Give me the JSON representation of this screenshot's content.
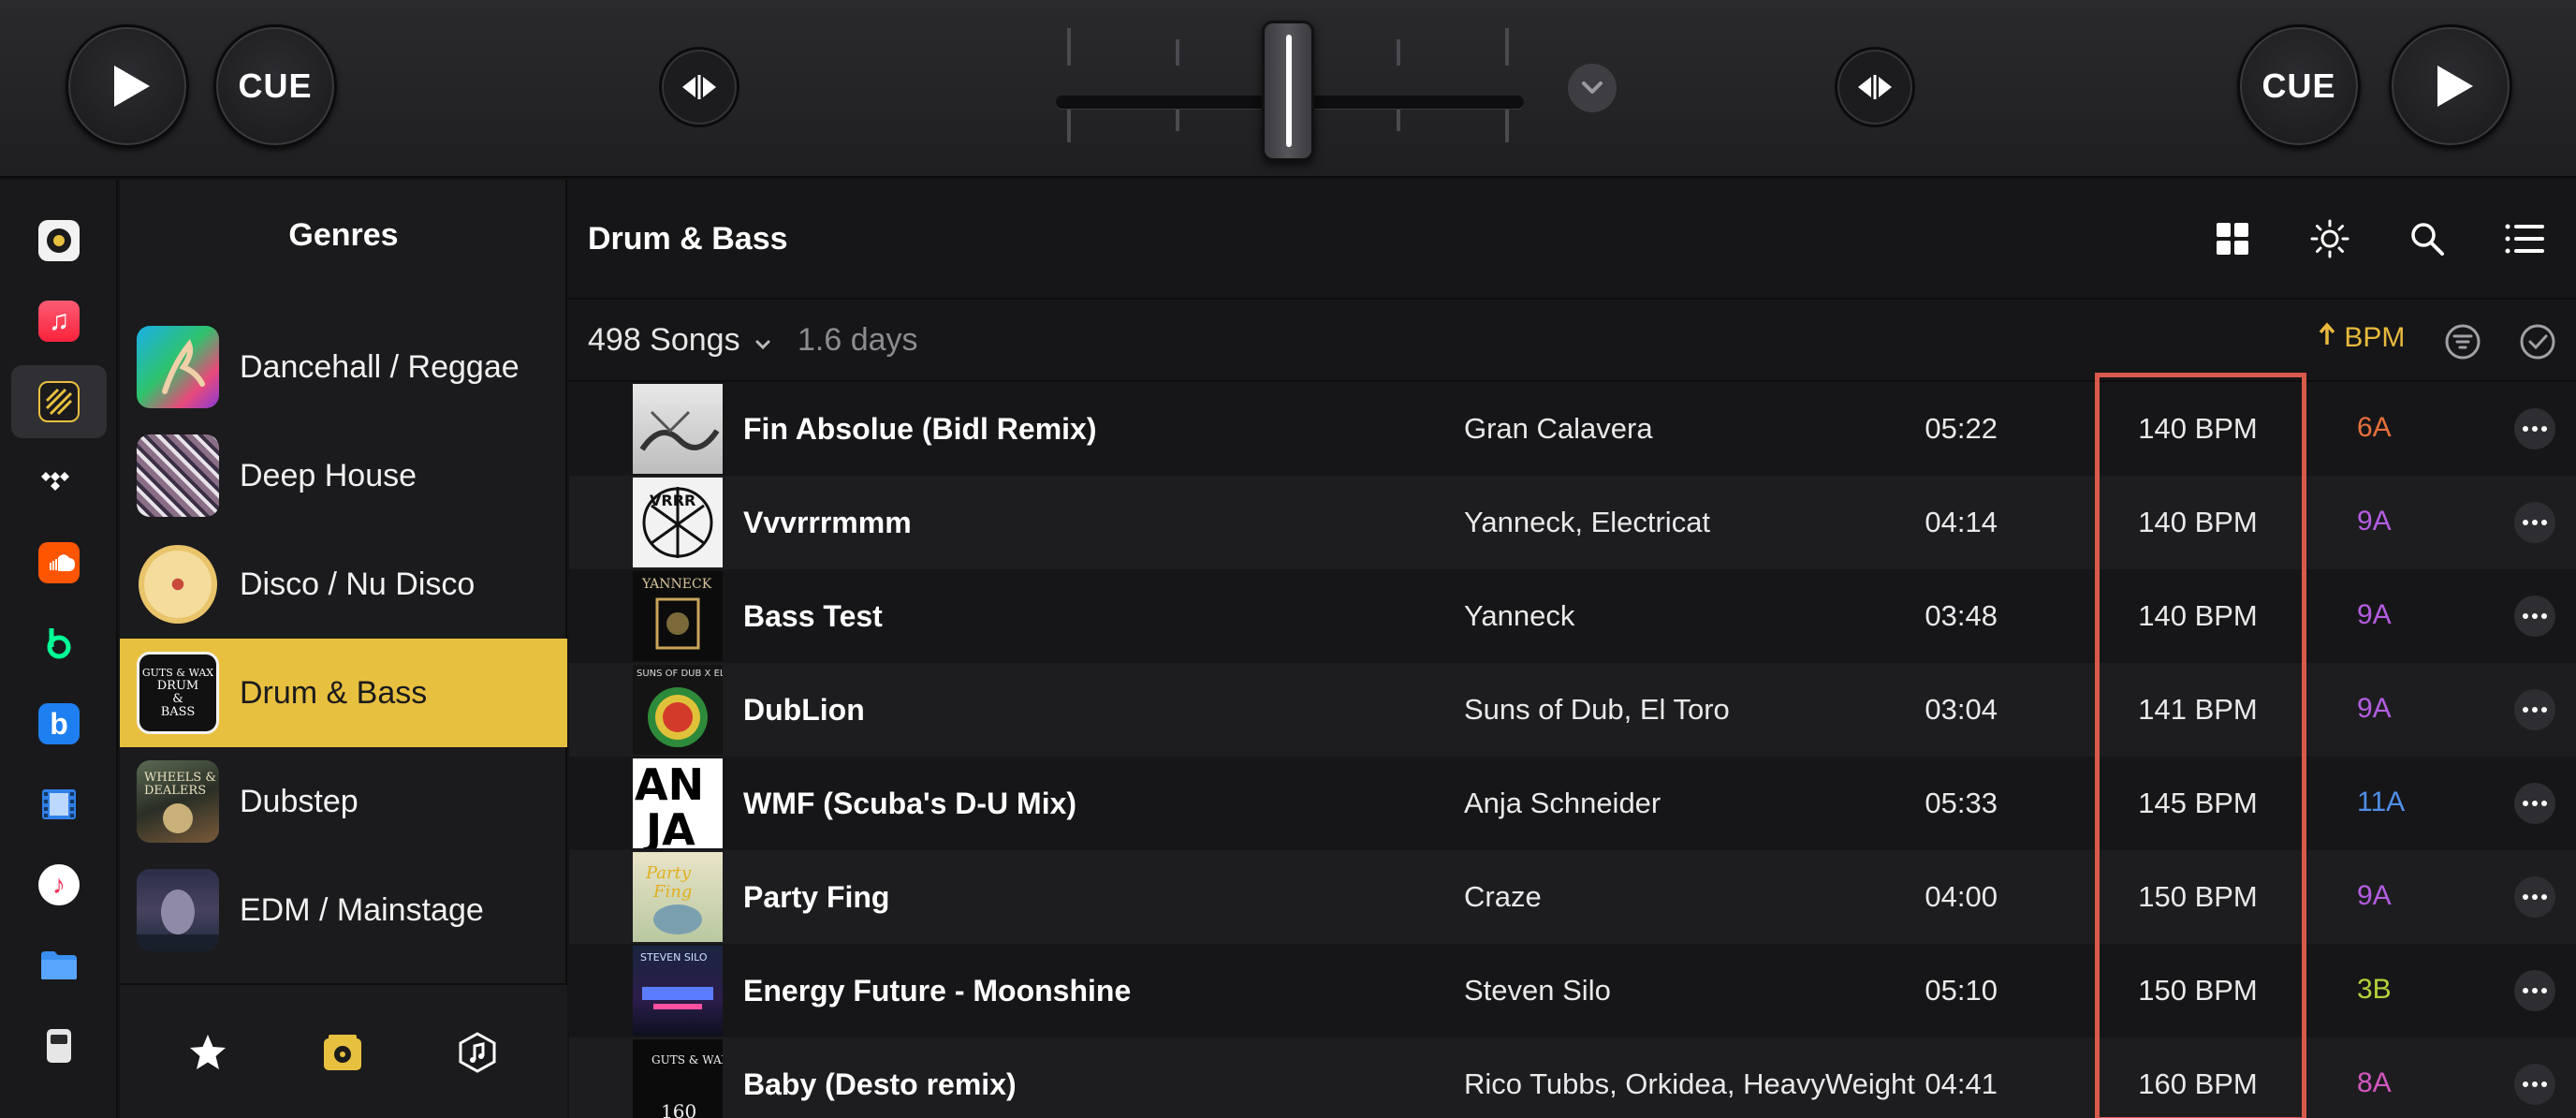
{
  "deck_left": {
    "cue_label": "CUE"
  },
  "deck_right": {
    "cue_label": "CUE"
  },
  "genres": {
    "title": "Genres",
    "items": [
      {
        "label": "Dancehall / Reggae"
      },
      {
        "label": "Deep House"
      },
      {
        "label": "Disco / Nu Disco"
      },
      {
        "label": "Drum & Bass"
      },
      {
        "label": "Dubstep"
      },
      {
        "label": "EDM / Mainstage"
      }
    ],
    "selected": "Drum & Bass"
  },
  "main": {
    "title": "Drum & Bass",
    "songs_count": "498 Songs",
    "duration": "1.6 days",
    "sort_label": "BPM",
    "tracks": [
      {
        "title": "Fin Absolue (Bidl Remix)",
        "artist": "Gran Calavera",
        "time": "05:22",
        "bpm": "140 BPM",
        "key": "6A",
        "key_color": "#e8703c"
      },
      {
        "title": "Vvvrrrmmm",
        "artist": "Yanneck, Electricat",
        "time": "04:14",
        "bpm": "140 BPM",
        "key": "9A",
        "key_color": "#b45de0"
      },
      {
        "title": "Bass Test",
        "artist": "Yanneck",
        "time": "03:48",
        "bpm": "140 BPM",
        "key": "9A",
        "key_color": "#b45de0"
      },
      {
        "title": "DubLion",
        "artist": "Suns of Dub, El Toro",
        "time": "03:04",
        "bpm": "141 BPM",
        "key": "9A",
        "key_color": "#b45de0"
      },
      {
        "title": "WMF (Scuba's D-U Mix)",
        "artist": "Anja Schneider",
        "time": "05:33",
        "bpm": "145 BPM",
        "key": "11A",
        "key_color": "#4f8fe8"
      },
      {
        "title": "Party Fing",
        "artist": "Craze",
        "time": "04:00",
        "bpm": "150 BPM",
        "key": "9A",
        "key_color": "#b45de0"
      },
      {
        "title": "Energy Future - Moonshine",
        "artist": "Steven Silo",
        "time": "05:10",
        "bpm": "150 BPM",
        "key": "3B",
        "key_color": "#b3d23a"
      },
      {
        "title": "Baby (Desto remix)",
        "artist": "Rico Tubbs, Orkidea, HeavyWeight",
        "time": "04:41",
        "bpm": "160 BPM",
        "key": "8A",
        "key_color": "#d357c0"
      }
    ]
  },
  "colors": {
    "accent": "#e8c03f",
    "sort_accent": "#e8b93c",
    "highlight_box": "#d9594a"
  }
}
